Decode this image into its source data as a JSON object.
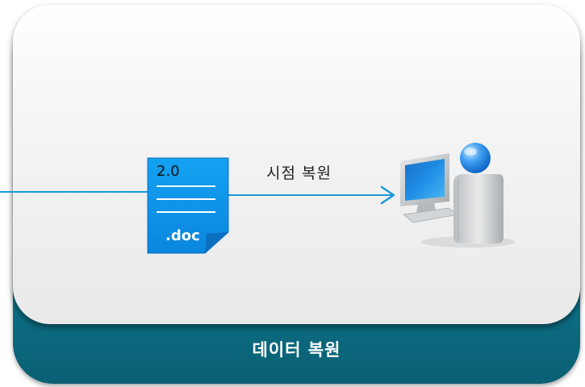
{
  "diagram": {
    "footer_label": "데이터 복원",
    "caption": "시점 복원",
    "document": {
      "version": "2.0",
      "extension": ".doc"
    },
    "icons": {
      "document": "document-icon",
      "computer": "computer-user-icon",
      "arrow": "arrow-right-icon"
    },
    "colors": {
      "teal": "#0f7f96",
      "document_blue": "#0e8fe6",
      "arrow_blue": "#1a9ad6"
    }
  }
}
